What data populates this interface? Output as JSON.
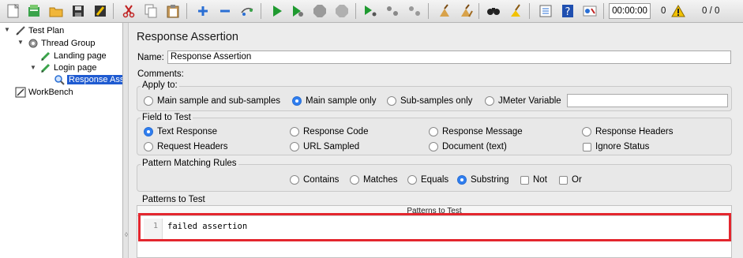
{
  "toolbar": {
    "timer": "00:00:00",
    "warning_count": "0",
    "thread_counter": "0 / 0"
  },
  "tree": {
    "items": [
      {
        "label": "Test Plan"
      },
      {
        "label": "Thread Group"
      },
      {
        "label": "Landing page"
      },
      {
        "label": "Login page"
      },
      {
        "label": "Response Assertion"
      },
      {
        "label": "WorkBench"
      }
    ]
  },
  "panel": {
    "title": "Response Assertion",
    "name_label": "Name:",
    "name_value": "Response Assertion",
    "comments_label": "Comments:"
  },
  "apply_to": {
    "title": "Apply to:",
    "options": [
      "Main sample and sub-samples",
      "Main sample only",
      "Sub-samples only",
      "JMeter Variable"
    ],
    "selected": "Main sample only",
    "variable_value": ""
  },
  "field_to_test": {
    "title": "Field to Test",
    "options": [
      "Text Response",
      "Response Code",
      "Response Message",
      "Response Headers",
      "Request Headers",
      "URL Sampled",
      "Document (text)",
      "Ignore Status"
    ],
    "selected": "Text Response",
    "ignore_status_checked": false
  },
  "pattern_rules": {
    "title": "Pattern Matching Rules",
    "options": [
      "Contains",
      "Matches",
      "Equals",
      "Substring",
      "Not",
      "Or"
    ],
    "selected": "Substring"
  },
  "patterns": {
    "title": "Patterns to Test",
    "column_header": "Patterns to Test",
    "lines": [
      {
        "number": "1",
        "text": "failed assertion"
      }
    ]
  },
  "colors": {
    "selection": "#1f5bd1",
    "radio_on": "#2f7ef0",
    "highlight_border": "#e3262e"
  }
}
